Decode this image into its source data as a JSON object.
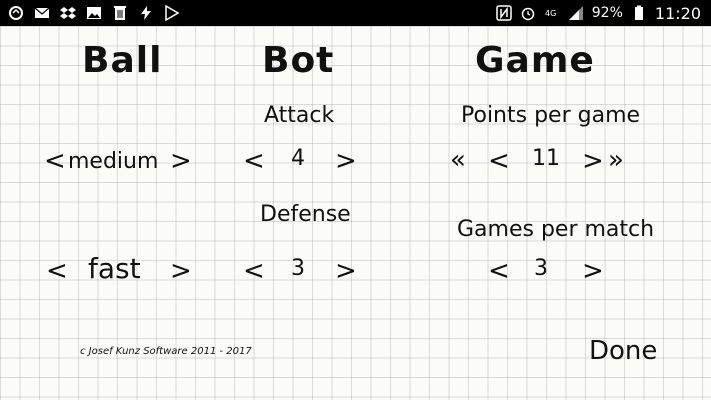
{
  "status": {
    "battery": "92%",
    "time": "11:20",
    "icons": [
      "sync-icon",
      "mail-icon",
      "dropbox-icon",
      "image-icon",
      "trash-icon",
      "flash-icon",
      "play-store-icon",
      "nfc-icon",
      "alarm-icon",
      "4g-icon",
      "signal-icon",
      "battery-icon"
    ]
  },
  "columns": {
    "ball": {
      "title": "Ball",
      "speed1": "medium",
      "speed2": "fast"
    },
    "bot": {
      "title": "Bot",
      "attack_label": "Attack",
      "attack_value": "4",
      "defense_label": "Defense",
      "defense_value": "3"
    },
    "game": {
      "title": "Game",
      "points_label": "Points per game",
      "points_value": "11",
      "games_label": "Games per match",
      "games_value": "3"
    }
  },
  "arrows": {
    "left": "<",
    "right": ">",
    "double_left": "«",
    "double_right": "»"
  },
  "footer": {
    "copyright": "c Josef Kunz Software 2011 - 2017",
    "done": "Done"
  }
}
